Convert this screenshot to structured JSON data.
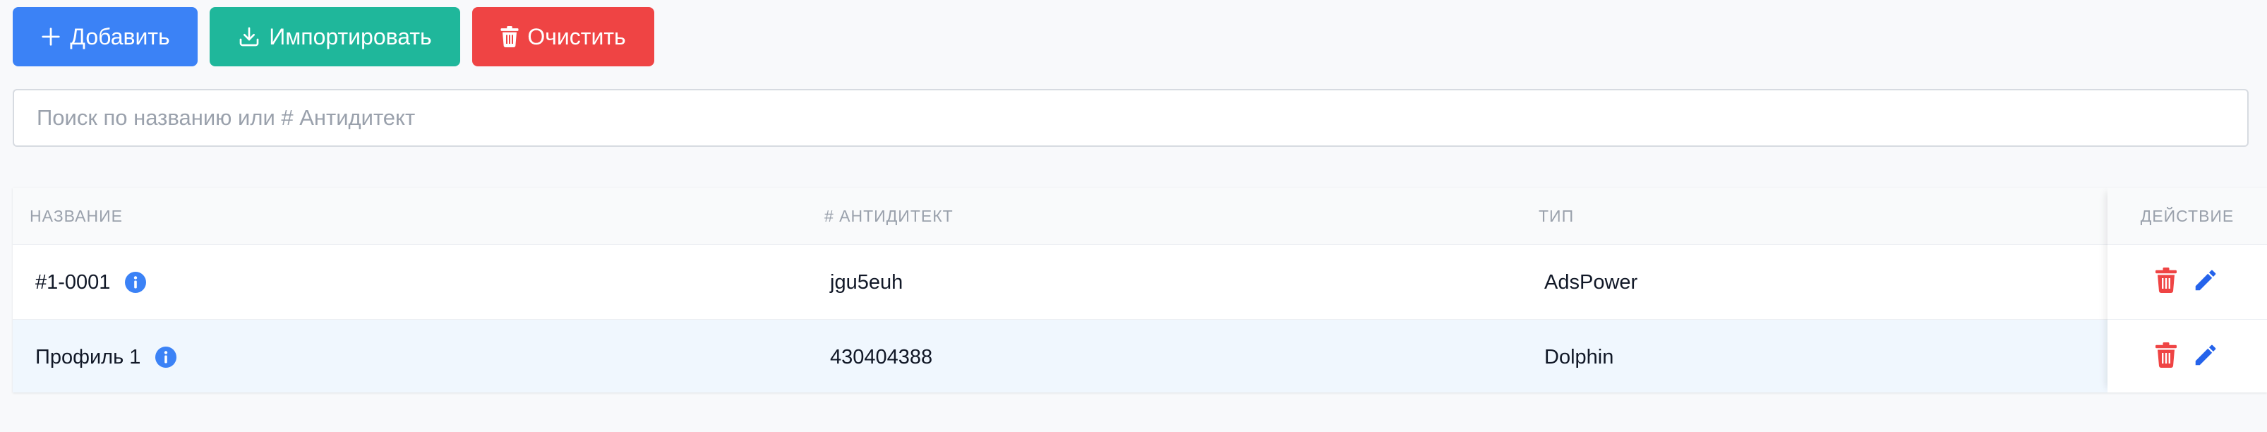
{
  "toolbar": {
    "add_label": "Добавить",
    "import_label": "Импортировать",
    "clear_label": "Очистить"
  },
  "search": {
    "placeholder": "Поиск по названию или # Антидитект",
    "value": ""
  },
  "table": {
    "columns": {
      "name": "НАЗВАНИЕ",
      "antidetect": "# АНТИДИТЕКТ",
      "type": "ТИП",
      "action": "ДЕЙСТВИЕ"
    },
    "rows": [
      {
        "name": "#1-0001",
        "antidetect": "jgu5euh",
        "type": "AdsPower"
      },
      {
        "name": "Профиль 1",
        "antidetect": "430404388",
        "type": "Dolphin"
      }
    ]
  },
  "colors": {
    "add": "#3b82f6",
    "import": "#1fb79b",
    "clear": "#ef4444",
    "info": "#3b82f6",
    "delete_icon": "#ef4444",
    "edit_icon": "#2563eb"
  },
  "icons": {
    "add": "plus-icon",
    "import": "download-icon",
    "clear": "trash-icon",
    "info": "info-icon",
    "delete": "trash-icon",
    "edit": "pencil-icon"
  }
}
